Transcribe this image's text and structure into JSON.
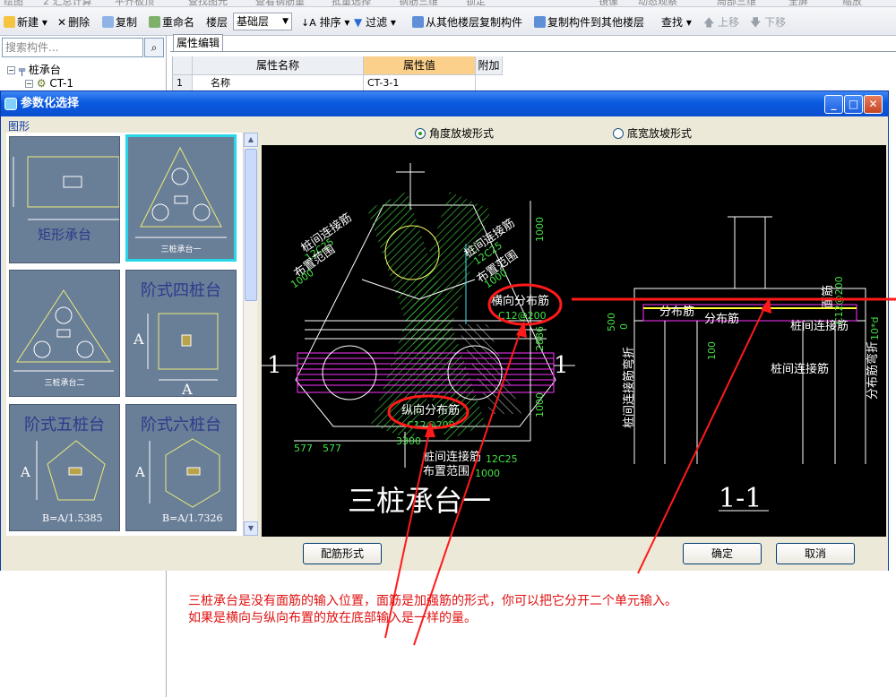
{
  "top_strip": [
    "绘图",
    "2 汇总计算",
    "平齐板顶",
    "查找图元",
    "查看钢筋量",
    "批量选择",
    "钢筋三维",
    "锁定",
    "",
    "镜像",
    "动态观察",
    "局部三维",
    "全屏",
    "缩放"
  ],
  "toolbar": {
    "new": "新建",
    "delete": "删除",
    "copy": "复制",
    "rename": "重命名",
    "floor_label": "楼层",
    "floor_value": "基础层",
    "sort": "排序",
    "filter": "过滤",
    "copy_from": "从其他楼层复制构件",
    "copy_to": "复制构件到其他楼层",
    "find": "查找",
    "move_up": "上移",
    "move_down": "下移"
  },
  "sidebar": {
    "search_placeholder": "搜索构件...",
    "tree_root": "桩承台",
    "tree_child": "CT-1"
  },
  "props": {
    "tab": "属性编辑",
    "col_name": "属性名称",
    "col_value": "属性值",
    "col_extra": "附加",
    "row_num": "1",
    "row_name": "名称",
    "row_value": "CT-3-1"
  },
  "dialog": {
    "title": "参数化选择",
    "group_label": "图形",
    "shapes": [
      {
        "label": "矩形承台"
      },
      {
        "label": "三桩承台一"
      },
      {
        "label": "三桩承台二"
      },
      {
        "label": "阶式四桩台"
      },
      {
        "label": "阶式五桩台",
        "sub": "B=A/1.5385"
      },
      {
        "label": "阶式六桩台",
        "sub": "B=A/1.7326"
      }
    ],
    "radio_angle": "角度放坡形式",
    "radio_width": "底宽放坡形式",
    "btn_rebar": "配筋形式",
    "btn_ok": "确定",
    "btn_cancel": "取消"
  },
  "drawing": {
    "title": "三桩承台一",
    "section_title": "1-1",
    "sec_mark": "1",
    "labels": {
      "pile_bar_l": "桩间连接筋",
      "pile_bar_l_val": "12C25",
      "range_l": "布置范围",
      "range_l_val": "1000",
      "pile_bar_r": "桩间连接筋",
      "pile_bar_r_val": "12C25",
      "range_r": "布置范围",
      "range_r_val": "1000",
      "h_dist": "横向分布筋",
      "h_dist_val": "C12@200",
      "v_dist": "纵向分布筋",
      "v_dist_val": "C12@200",
      "bottom_bar": "桩间连接筋",
      "bottom_bar_val": "12C25",
      "bottom_range": "布置范围",
      "bottom_range_val": "1000",
      "dim_577a": "577",
      "dim_577b": "577",
      "dim_3300": "3300",
      "dim_1000a": "1000",
      "dim_2886": "2886",
      "dim_1000b": "1000",
      "s_dist1": "分布筋",
      "s_dist2": "分布筋",
      "s_pile": "桩间连接筋",
      "s_pile2": "桩间连接筋",
      "s_500": "500",
      "s_0": "0",
      "s_100": "100",
      "s_v1": "桩间连接筋弯折",
      "s_v2": "分布筋弯折",
      "s_v3": "面筋",
      "s_v4": "C12@200",
      "s_10d": "10*d"
    }
  },
  "annotation": {
    "line1": "三桩承台是没有面筋的输入位置，面筋是加强筋的形式，你可以把它分开二个单元输入。",
    "line2": "如果是横向与纵向布置的放在底部输入是一样的量。"
  }
}
